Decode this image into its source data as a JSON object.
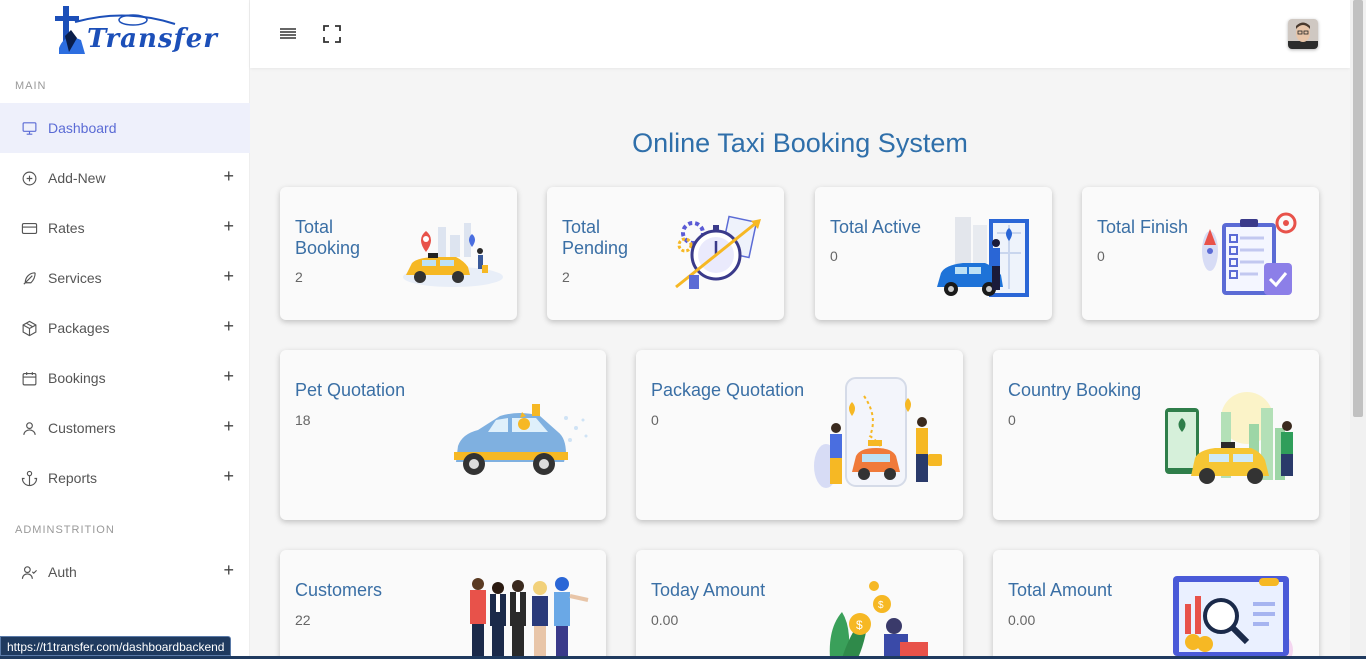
{
  "logo": {
    "text": "Transfer"
  },
  "sidebar": {
    "main_label": "MAIN",
    "admin_label": "ADMINSTRITION",
    "items": [
      {
        "label": "Dashboard",
        "icon": "monitor-icon",
        "active": true
      },
      {
        "label": "Add-New",
        "icon": "plus-circle-icon"
      },
      {
        "label": "Rates",
        "icon": "credit-card-icon"
      },
      {
        "label": "Services",
        "icon": "feather-icon"
      },
      {
        "label": "Packages",
        "icon": "package-icon"
      },
      {
        "label": "Bookings",
        "icon": "calendar-icon"
      },
      {
        "label": "Customers",
        "icon": "user-icon"
      },
      {
        "label": "Reports",
        "icon": "anchor-icon"
      }
    ],
    "admin_items": [
      {
        "label": "Auth",
        "icon": "user-check-icon"
      }
    ],
    "expand_symbol": "+"
  },
  "main": {
    "title": "Online Taxi Booking System",
    "cards": [
      {
        "title": "Total Booking",
        "value": "2",
        "illustration": "taxi-map-icon"
      },
      {
        "title": "Total Pending",
        "value": "2",
        "illustration": "stopwatch-icon"
      },
      {
        "title": "Total Active",
        "value": "0",
        "illustration": "car-driver-icon"
      },
      {
        "title": "Total Finish",
        "value": "0",
        "illustration": "checklist-icon"
      },
      {
        "title": "Pet Quotation",
        "value": "18",
        "illustration": "pet-car-icon"
      },
      {
        "title": "Package Quotation",
        "value": "0",
        "illustration": "phone-taxi-icon"
      },
      {
        "title": "Country Booking",
        "value": "0",
        "illustration": "city-taxi-icon"
      },
      {
        "title": "Customers",
        "value": "22",
        "illustration": "people-group-icon"
      },
      {
        "title": "Today Amount",
        "value": "0.00",
        "illustration": "coins-icon"
      },
      {
        "title": "Total Amount",
        "value": "0.00",
        "illustration": "analytics-icon"
      }
    ]
  },
  "statusbar": {
    "url": "https://t1transfer.com/dashboardbackend"
  },
  "colors": {
    "accent": "#5b6bd5",
    "title": "#2f6faa",
    "taxi_yellow": "#f6b824",
    "car_blue": "#1e73d8"
  }
}
